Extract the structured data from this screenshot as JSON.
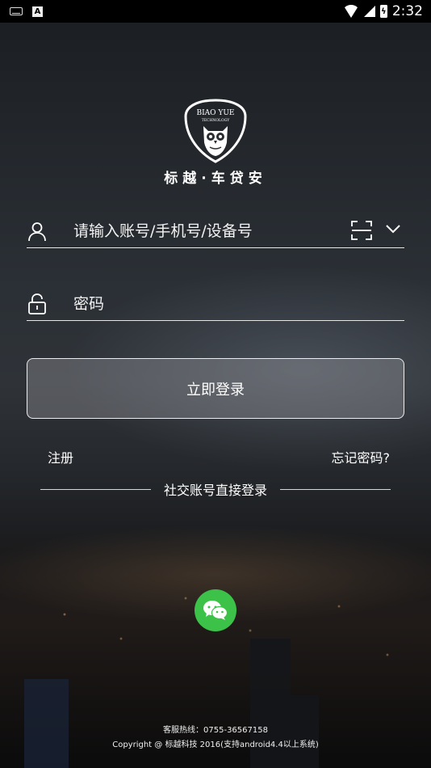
{
  "status_bar": {
    "time": "2:32"
  },
  "brand": {
    "logo_text_top": "BIAO YUE",
    "logo_text_sub": "TECHNOLOGY",
    "name": "标越·车贷安"
  },
  "login_form": {
    "account_placeholder": "请输入账号/手机号/设备号",
    "account_value": "",
    "password_placeholder": "密码",
    "password_value": "",
    "login_button": "立即登录"
  },
  "links": {
    "register": "注册",
    "forgot_password": "忘记密码?"
  },
  "social": {
    "divider_text": "社交账号直接登录",
    "wechat_icon": "wechat-icon"
  },
  "footer": {
    "hotline": "客服热线：0755-36567158",
    "copyright": "Copyright @ 标越科技 2016(支持android4.4以上系统)"
  },
  "colors": {
    "wechat_green": "#3cc249",
    "status_bar": "#000000"
  }
}
